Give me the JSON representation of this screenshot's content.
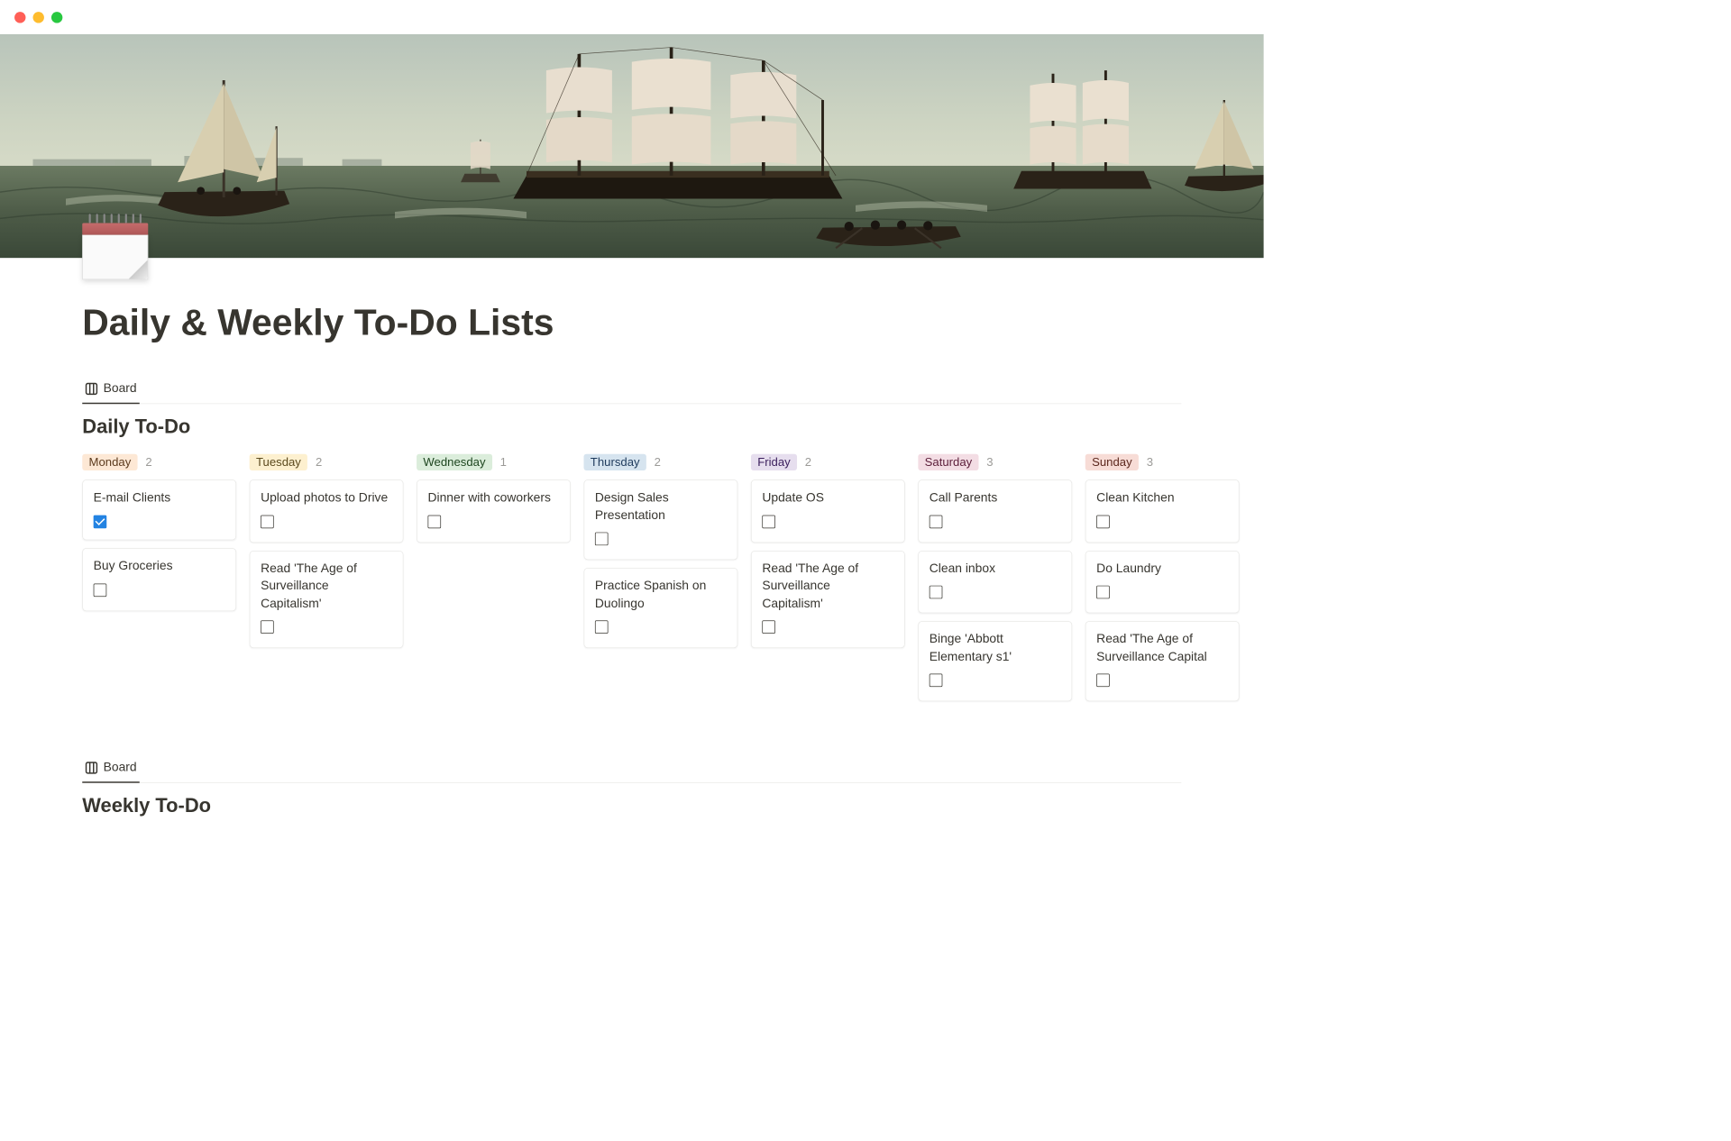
{
  "page": {
    "title": "Daily & Weekly To-Do Lists"
  },
  "views": {
    "board_label": "Board"
  },
  "daily": {
    "title": "Daily To-Do",
    "columns": [
      {
        "day": "Monday",
        "count": "2",
        "tag_class": "tag-mon",
        "cards": [
          {
            "title": "E-mail Clients",
            "checked": true
          },
          {
            "title": "Buy Groceries",
            "checked": false
          }
        ]
      },
      {
        "day": "Tuesday",
        "count": "2",
        "tag_class": "tag-tue",
        "cards": [
          {
            "title": "Upload photos to Drive",
            "checked": false
          },
          {
            "title": "Read 'The Age of Surveillance Capitalism'",
            "checked": false
          }
        ]
      },
      {
        "day": "Wednesday",
        "count": "1",
        "tag_class": "tag-wed",
        "cards": [
          {
            "title": "Dinner with coworkers",
            "checked": false
          }
        ]
      },
      {
        "day": "Thursday",
        "count": "2",
        "tag_class": "tag-thu",
        "cards": [
          {
            "title": "Design Sales Presentation",
            "checked": false
          },
          {
            "title": "Practice Spanish on Duolingo",
            "checked": false
          }
        ]
      },
      {
        "day": "Friday",
        "count": "2",
        "tag_class": "tag-fri",
        "cards": [
          {
            "title": "Update OS",
            "checked": false
          },
          {
            "title": "Read 'The Age of Surveillance Capitalism'",
            "checked": false
          }
        ]
      },
      {
        "day": "Saturday",
        "count": "3",
        "tag_class": "tag-sat",
        "cards": [
          {
            "title": "Call Parents",
            "checked": false
          },
          {
            "title": "Clean inbox",
            "checked": false
          },
          {
            "title": "Binge 'Abbott Elementary s1'",
            "checked": false
          }
        ]
      },
      {
        "day": "Sunday",
        "count": "3",
        "tag_class": "tag-sun",
        "cards": [
          {
            "title": "Clean Kitchen",
            "checked": false
          },
          {
            "title": "Do Laundry",
            "checked": false
          },
          {
            "title": "Read 'The Age of Surveillance Capital",
            "checked": false
          }
        ]
      }
    ]
  },
  "weekly": {
    "title": "Weekly To-Do"
  }
}
